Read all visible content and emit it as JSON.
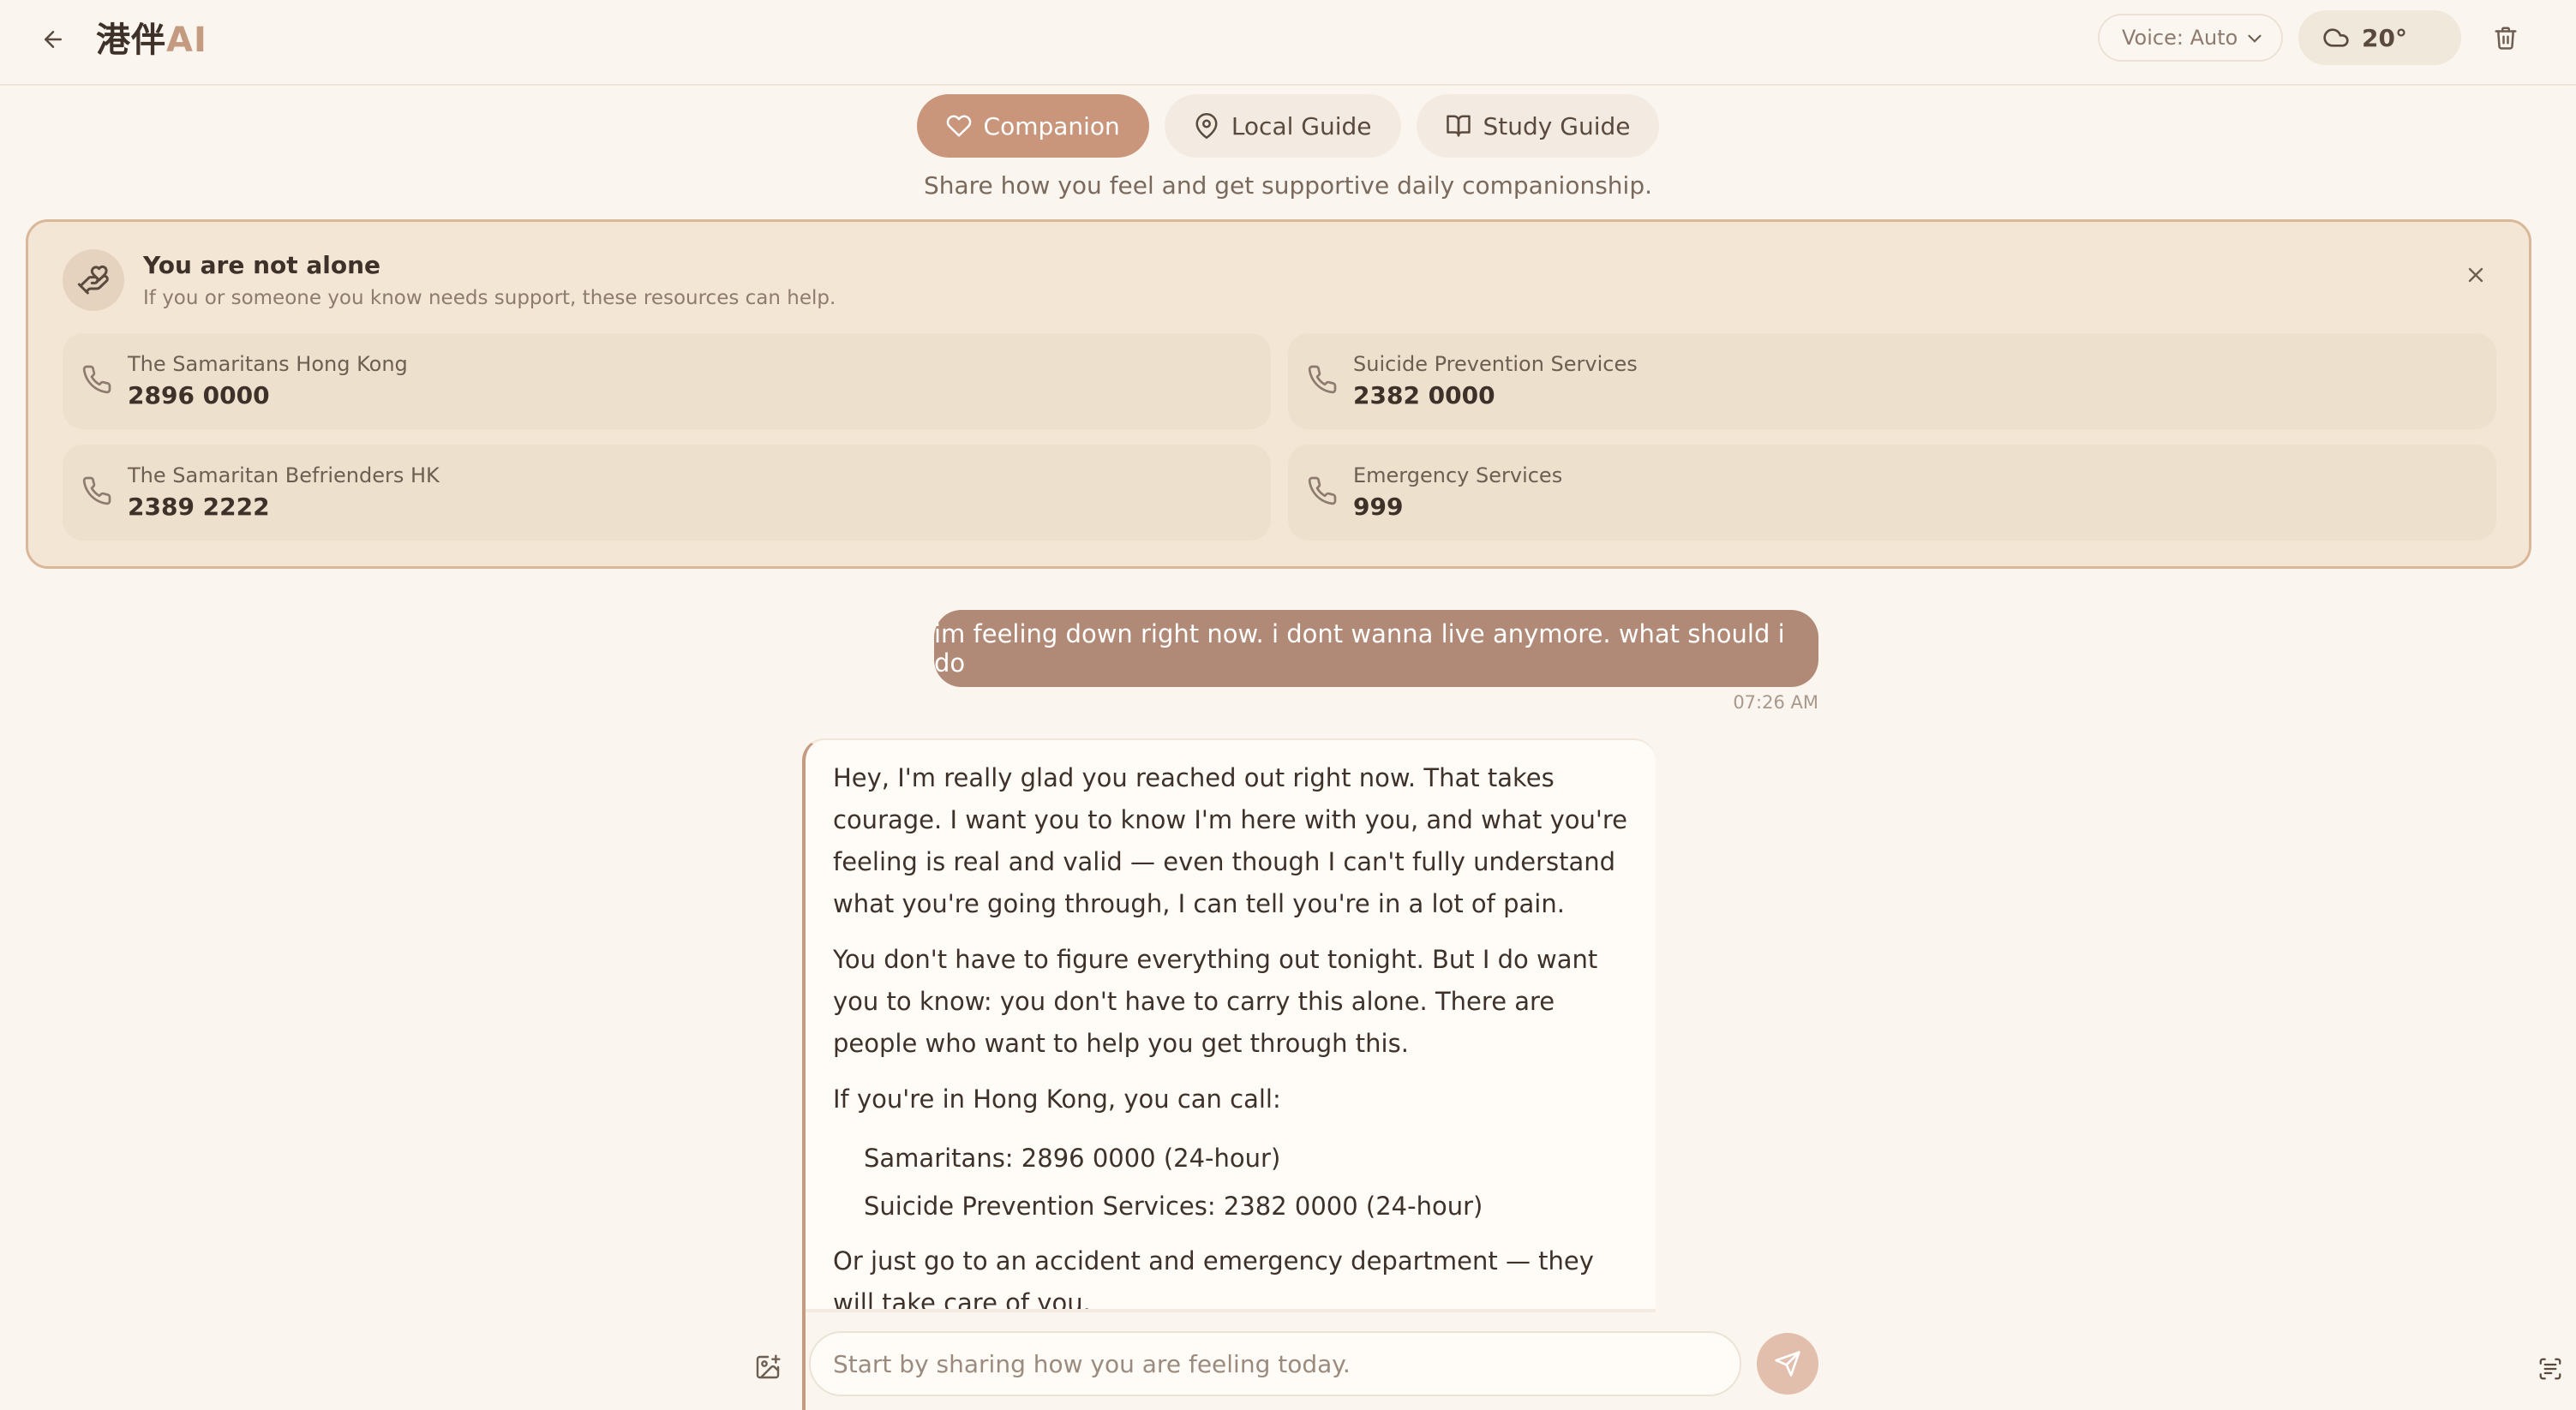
{
  "header": {
    "brand_cn": "港伴",
    "brand_ai": "AI",
    "voice_label": "Voice: Auto",
    "weather_temp": "20°",
    "icons": {
      "back": "arrow-left-icon",
      "weather": "cloud-icon",
      "trash": "trash-icon",
      "chevron": "chevron-down-icon"
    }
  },
  "modes": {
    "tabs": [
      {
        "label": "Companion",
        "icon": "heart-icon",
        "active": true
      },
      {
        "label": "Local Guide",
        "icon": "map-pin-icon",
        "active": false
      },
      {
        "label": "Study Guide",
        "icon": "book-open-icon",
        "active": false
      }
    ],
    "description": "Share how you feel and get supportive daily companionship."
  },
  "crisis": {
    "title": "You are not alone",
    "subtitle": "If you or someone you know needs support, these resources can help.",
    "hotlines": [
      {
        "name": "The Samaritans Hong Kong",
        "number": "2896 0000"
      },
      {
        "name": "Suicide Prevention Services",
        "number": "2382 0000"
      },
      {
        "name": "The Samaritan Befrienders HK",
        "number": "2389 2222"
      },
      {
        "name": "Emergency Services",
        "number": "999"
      }
    ]
  },
  "chat": {
    "user_message": "im feeling down right now. i dont wanna live anymore. what should i do",
    "user_time": "07:26 AM",
    "ai_paragraphs": [
      "Hey, I'm really glad you reached out right now. That takes courage. I want you to know I'm here with you, and what you're feeling is real and valid — even though I can't fully understand what you're going through, I can tell you're in a lot of pain.",
      "You don't have to figure everything out tonight. But I do want you to know: you don't have to carry this alone. There are people who want to help you get through this.",
      "If you're in Hong Kong, you can call:"
    ],
    "ai_list": [
      "Samaritans: 2896 0000 (24-hour)",
      "Suicide Prevention Services: 2382 0000 (24-hour)"
    ],
    "ai_closing": "Or just go to an accident and emergency department — they will take care of you.",
    "input_placeholder": "Start by sharing how you are feeling today."
  },
  "colors": {
    "accent": "#c9967c",
    "background": "#faf5ee",
    "user_bubble": "#b08a76",
    "crisis_border": "#d9b89a"
  }
}
